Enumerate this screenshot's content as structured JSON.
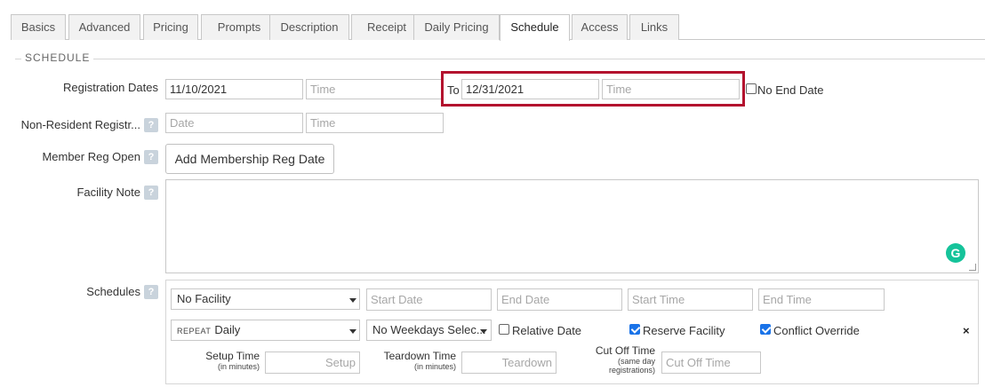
{
  "tabs": [
    "Basics",
    "Advanced",
    "Pricing",
    "Prompts",
    "Description",
    "Receipt",
    "Daily Pricing",
    "Schedule",
    "Access",
    "Links"
  ],
  "active_tab": "Schedule",
  "section_title": "SCHEDULE",
  "registration": {
    "label": "Registration Dates",
    "start_date": "11/10/2021",
    "start_time_placeholder": "Time",
    "to_label": "To",
    "end_date": "12/31/2021",
    "end_time_placeholder": "Time",
    "no_end_date_label": "No End Date"
  },
  "non_resident": {
    "label": "Non-Resident Registr...",
    "date_placeholder": "Date",
    "time_placeholder": "Time"
  },
  "member_reg": {
    "label": "Member Reg Open",
    "button_label": "Add Membership Reg Date"
  },
  "facility_note": {
    "label": "Facility Note",
    "grammarly_glyph": "G"
  },
  "schedules": {
    "label": "Schedules",
    "facility_select": "No Facility",
    "start_date_placeholder": "Start Date",
    "end_date_placeholder": "End Date",
    "start_time_placeholder": "Start Time",
    "end_time_placeholder": "End Time",
    "repeat_prefix": "REPEAT",
    "repeat_value": "Daily",
    "weekdays_select": "No Weekdays Selec...",
    "relative_date_label": "Relative Date",
    "reserve_facility_label": "Reserve Facility",
    "conflict_override_label": "Conflict Override",
    "remove_glyph": "×",
    "setup_time_label": "Setup Time",
    "setup_time_unit": "(in minutes)",
    "setup_placeholder": "Setup",
    "teardown_time_label": "Teardown Time",
    "teardown_time_unit": "(in minutes)",
    "teardown_placeholder": "Teardown",
    "cutoff_label": "Cut Off Time",
    "cutoff_sub1": "(same day",
    "cutoff_sub2": "registrations)",
    "cutoff_placeholder": "Cut Off Time"
  },
  "help_glyph": "?",
  "colors": {
    "highlight": "#b3112e",
    "checkbox_checked": "#1a73e8",
    "grammarly": "#15c39a",
    "help_badge": "#c9d3dc"
  }
}
